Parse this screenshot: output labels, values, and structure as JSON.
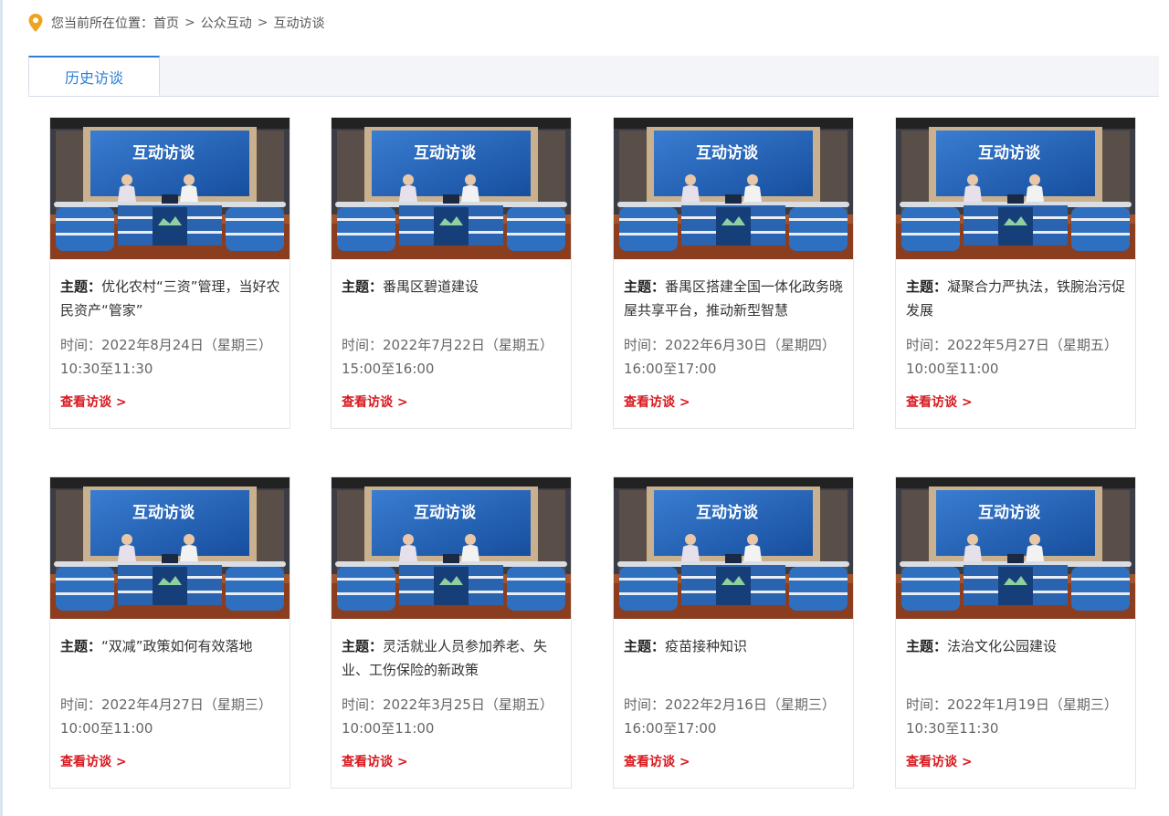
{
  "breadcrumb": {
    "prefix": "您当前所在位置：",
    "items": [
      "首页",
      "公众互动",
      "互动访谈"
    ],
    "separator": ">"
  },
  "tabs": [
    {
      "label": "历史访谈",
      "active": true
    }
  ],
  "labels": {
    "topic": "主题：",
    "time": "时间：",
    "more": "查看访谈 >"
  },
  "thumbnail_title": "互动访谈",
  "cards": [
    {
      "topic": "优化农村“三资”管理，当好农民资产“管家”",
      "time": "2022年8月24日（星期三）10:30至11:30"
    },
    {
      "topic": "番禺区碧道建设",
      "time": "2022年7月22日（星期五）15:00至16:00"
    },
    {
      "topic": "番禺区搭建全国一体化政务晓屋共享平台，推动新型智慧",
      "time": "2022年6月30日（星期四）16:00至17:00"
    },
    {
      "topic": "凝聚合力严执法，铁腕治污促发展",
      "time": "2022年5月27日（星期五）10:00至11:00"
    },
    {
      "topic": "“双减”政策如何有效落地",
      "time": "2022年4月27日（星期三）10:00至11:00"
    },
    {
      "topic": "灵活就业人员参加养老、失业、工伤保险的新政策",
      "time": "2022年3月25日（星期五）10:00至11:00"
    },
    {
      "topic": "疫苗接种知识",
      "time": "2022年2月16日（星期三）16:00至17:00"
    },
    {
      "topic": "法治文化公园建设",
      "time": "2022年1月19日（星期三）10:30至11:30"
    }
  ],
  "colors": {
    "accent": "#2d7fd3",
    "link": "#d7191f",
    "screen": "#1d5fb8",
    "desk": "#2f6fc0"
  }
}
